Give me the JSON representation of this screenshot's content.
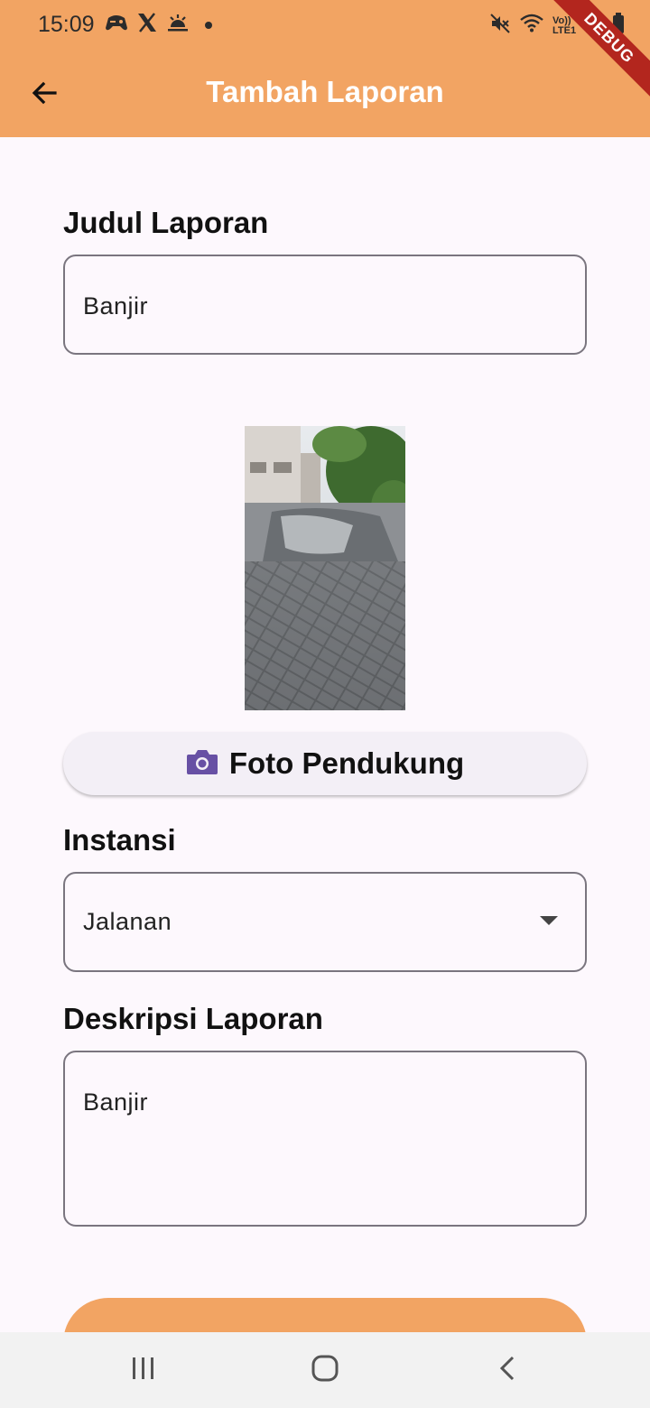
{
  "status_bar": {
    "time": "15:09",
    "left_icons": [
      "gamepad-icon",
      "x-logo-icon",
      "weather-icon",
      "dot-icon"
    ],
    "right_icons": [
      "mute-icon",
      "wifi-icon",
      "volte-lte-icon",
      "signal-icon",
      "battery-icon"
    ],
    "volte_text": "Vo))",
    "lte_text": "LTE1"
  },
  "debug_banner": "DEBUG",
  "app_bar": {
    "title": "Tambah Laporan",
    "back_icon": "arrow-back-icon",
    "background": "#f2a463"
  },
  "form": {
    "title_label": "Judul Laporan",
    "title_value": "Banjir",
    "photo_alt": "flooded street photo",
    "photo_button_label": "Foto Pendukung",
    "photo_button_icon": "camera-icon",
    "instansi_label": "Instansi",
    "instansi_value": "Jalanan",
    "description_label": "Deskripsi Laporan",
    "description_value": "Banjir",
    "submit_color": "#f2a463"
  },
  "nav_bar": {
    "items": [
      "recent-apps-icon",
      "home-icon",
      "back-icon"
    ]
  },
  "colors": {
    "accent": "#f2a463",
    "camera_icon": "#6750a4",
    "field_border": "#7a757f",
    "background": "#fdf8fd"
  }
}
